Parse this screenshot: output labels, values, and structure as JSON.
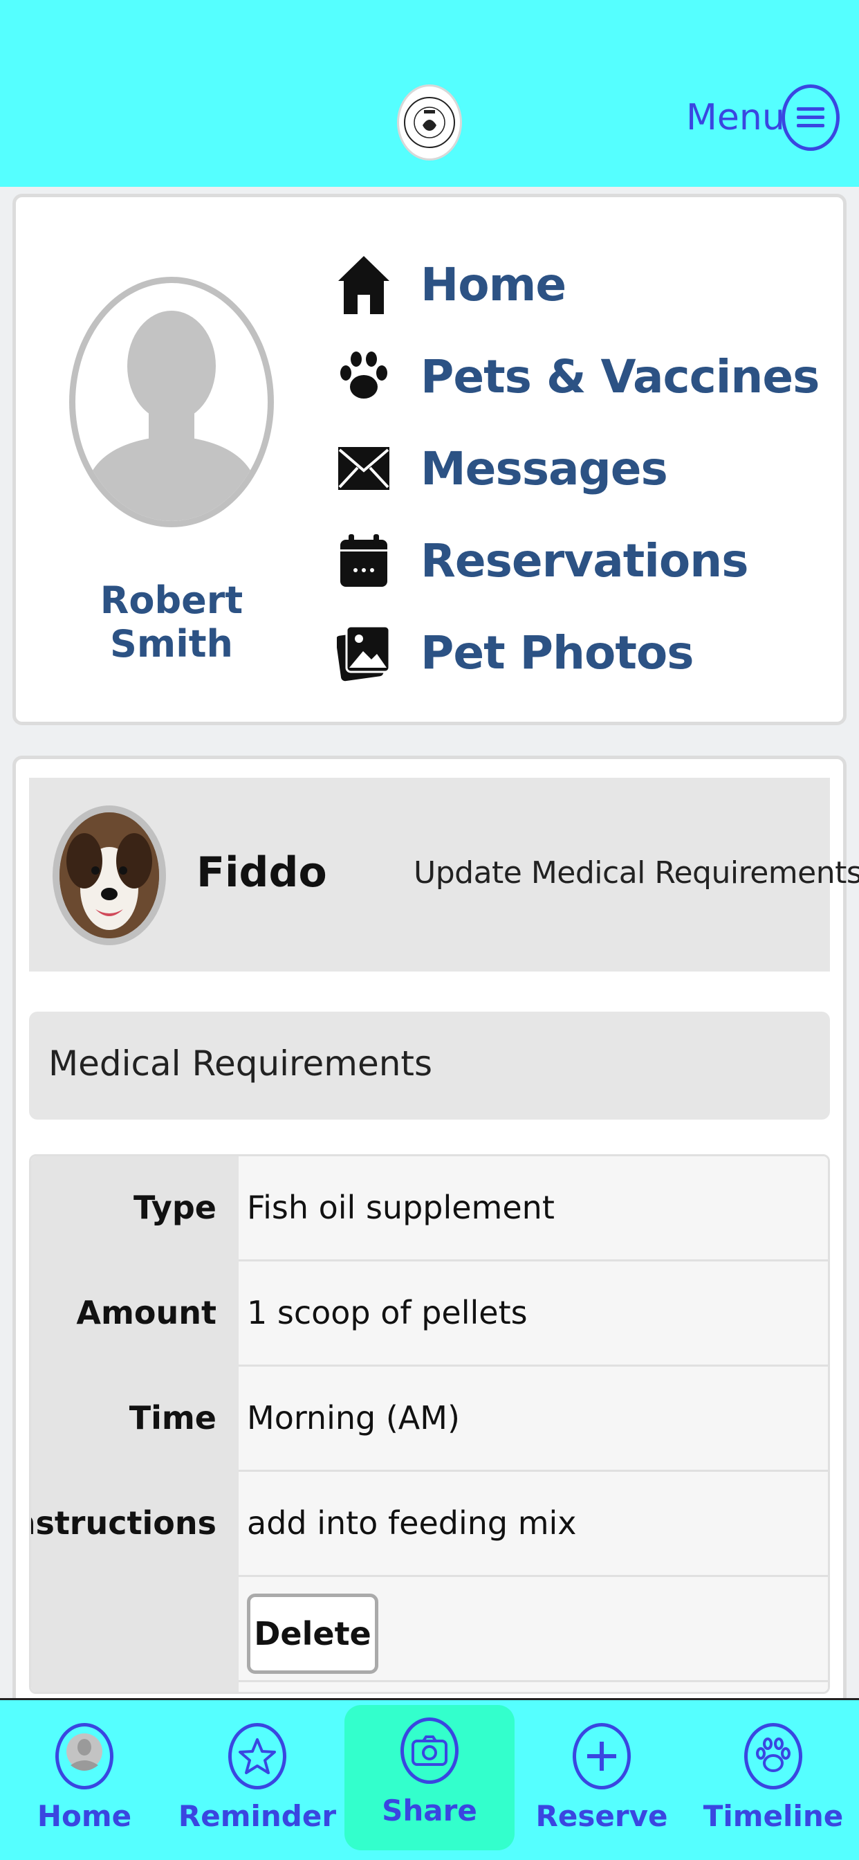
{
  "header": {
    "menu_label": "Menu",
    "colors": {
      "background": "#55ffff",
      "accent": "#3a46e0"
    }
  },
  "profile": {
    "name": "Robert Smith",
    "nav": [
      {
        "label": "Home",
        "icon": "home-icon"
      },
      {
        "label": "Pets & Vaccines",
        "icon": "paw-icon"
      },
      {
        "label": "Messages",
        "icon": "envelope-icon"
      },
      {
        "label": "Reservations",
        "icon": "calendar-icon"
      },
      {
        "label": "Pet Photos",
        "icon": "photos-icon"
      }
    ]
  },
  "pet": {
    "name": "Fiddo",
    "update_link": "Update Medical Requirements"
  },
  "medical": {
    "section_title": "Medical Requirements",
    "rows": [
      {
        "label": "Type",
        "value": "Fish oil supplement"
      },
      {
        "label": "Amount",
        "value": "1 scoop of pellets"
      },
      {
        "label": "Time",
        "value": "Morning (AM)"
      },
      {
        "label": "Instructions",
        "value": "add into feeding mix"
      }
    ],
    "delete_label": "Delete"
  },
  "tabbar": {
    "items": [
      {
        "label": "Home",
        "icon": "user-icon"
      },
      {
        "label": "Reminder",
        "icon": "star-icon"
      },
      {
        "label": "Share",
        "icon": "camera-icon",
        "active": true
      },
      {
        "label": "Reserve",
        "icon": "plus-icon"
      },
      {
        "label": "Timeline",
        "icon": "paw-icon"
      }
    ]
  }
}
